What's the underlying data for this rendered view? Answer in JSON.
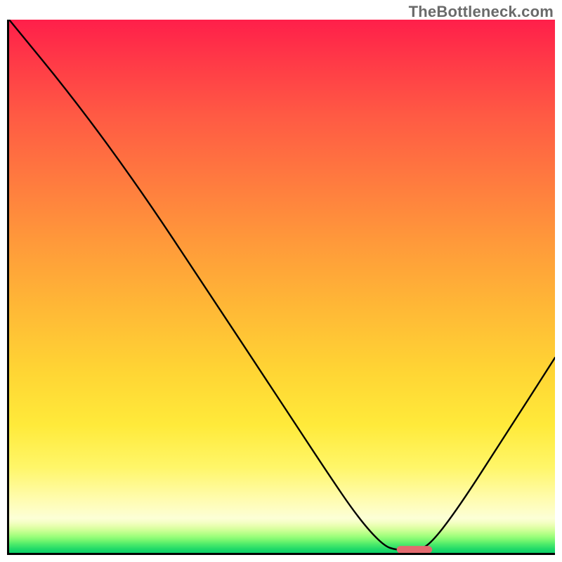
{
  "watermark": "TheBottleneck.com",
  "chart_data": {
    "type": "line",
    "title": "",
    "xlabel": "",
    "ylabel": "",
    "xlim": [
      0,
      100
    ],
    "ylim": [
      0,
      100
    ],
    "grid": false,
    "curve": {
      "name": "bottleneck-curve",
      "points": [
        {
          "x": 0.0,
          "y": 100.0
        },
        {
          "x": 12.0,
          "y": 85.0
        },
        {
          "x": 24.0,
          "y": 68.2
        },
        {
          "x": 36.0,
          "y": 49.7
        },
        {
          "x": 48.0,
          "y": 31.1
        },
        {
          "x": 58.0,
          "y": 15.5
        },
        {
          "x": 64.0,
          "y": 6.5
        },
        {
          "x": 68.5,
          "y": 1.4
        },
        {
          "x": 71.0,
          "y": 0.5
        },
        {
          "x": 74.5,
          "y": 0.5
        },
        {
          "x": 77.0,
          "y": 1.4
        },
        {
          "x": 82.0,
          "y": 8.0
        },
        {
          "x": 90.0,
          "y": 20.6
        },
        {
          "x": 100.0,
          "y": 36.6
        }
      ]
    },
    "marker_band": {
      "name": "optimal-zone",
      "x_start": 71.0,
      "x_end": 77.5,
      "y": 0.6,
      "color": "#e26a6f",
      "thickness_pct": 1.4
    },
    "gradient_stops": [
      {
        "pos": 0.0,
        "color": "#ff1f4a"
      },
      {
        "pos": 0.3,
        "color": "#ff7a3f"
      },
      {
        "pos": 0.66,
        "color": "#ffd534"
      },
      {
        "pos": 0.9,
        "color": "#fffcb0"
      },
      {
        "pos": 1.0,
        "color": "#0ccf68"
      }
    ]
  }
}
